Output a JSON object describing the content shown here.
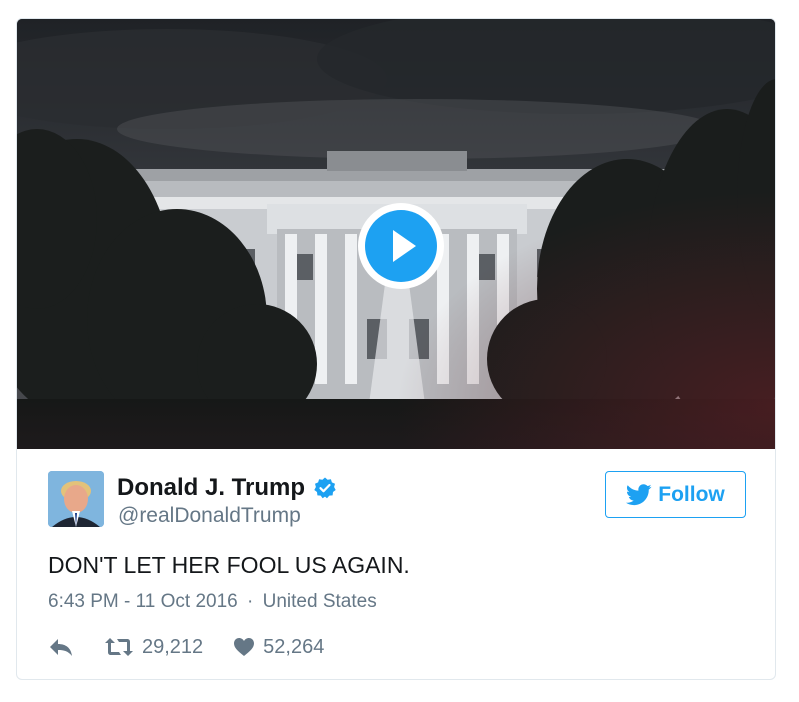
{
  "tweet": {
    "display_name": "Donald J. Trump",
    "handle": "@realDonaldTrump",
    "verified": true,
    "follow_label": "Follow",
    "text": "DON'T LET HER FOOL US AGAIN.",
    "timestamp": "6:43 PM - 11 Oct 2016",
    "separator": "·",
    "location": "United States",
    "retweet_count": "29,212",
    "like_count": "52,264"
  },
  "icons": {
    "play": "play-icon",
    "verified": "verified-badge-icon",
    "follow": "twitter-bird-icon",
    "reply": "reply-icon",
    "retweet": "retweet-icon",
    "like": "heart-icon"
  },
  "colors": {
    "accent": "#1da1f2",
    "text_primary": "#14171a",
    "text_secondary": "#657786",
    "border": "#e1e8ed"
  }
}
